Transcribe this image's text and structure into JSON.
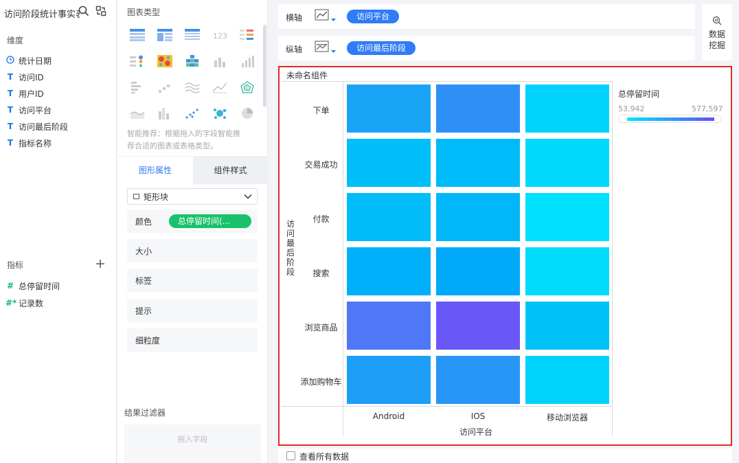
{
  "left_panel": {
    "dataset_title": "访问阶段统计事实表",
    "dimensions_title": "维度",
    "dimensions": [
      {
        "type_icon": "clock-icon",
        "label": "统计日期"
      },
      {
        "type_icon": "text-type-icon",
        "label": "访问ID"
      },
      {
        "type_icon": "text-type-icon",
        "label": "用户ID"
      },
      {
        "type_icon": "text-type-icon",
        "label": "访问平台"
      },
      {
        "type_icon": "text-type-icon",
        "label": "访问最后阶段"
      },
      {
        "type_icon": "text-type-icon",
        "label": "指标名称"
      }
    ],
    "metrics_title": "指标",
    "metrics": [
      {
        "type_icon": "hash-icon",
        "label": "总停留时间"
      },
      {
        "type_icon": "hash-star-icon",
        "label": "记录数"
      }
    ],
    "type_glyphs": {
      "text": "T",
      "hash": "#",
      "hash_star": "#*"
    }
  },
  "config_panel": {
    "chart_types_title": "图表类型",
    "recommendation": "智能推荐：根据拖入的字段智能推荐合适的图表或表格类型。",
    "tabs": [
      "图形属性",
      "组件样式"
    ],
    "shape_select": "矩形块",
    "properties": [
      {
        "label": "颜色",
        "value": "总停留时间(..."
      },
      {
        "label": "大小"
      },
      {
        "label": "标签"
      },
      {
        "label": "提示"
      },
      {
        "label": "细粒度"
      }
    ],
    "filter_title": "结果过滤器",
    "filter_placeholder": "拖入字段",
    "icon_123": "123"
  },
  "axes": {
    "x_label": "横轴",
    "x_field": "访问平台",
    "y_label": "纵轴",
    "y_field": "访问最后阶段"
  },
  "data_mining": {
    "line1": "数据",
    "line2": "挖掘"
  },
  "component": {
    "title": "未命名组件",
    "legend_title": "总停留时间",
    "legend_min": "53,942",
    "legend_max": "577,597"
  },
  "chart_data": {
    "type": "heatmap",
    "x_title": "访问平台",
    "y_title": "访问最后阶段",
    "x_categories": [
      "Android",
      "IOS",
      "移动浏览器"
    ],
    "y_categories": [
      "下单",
      "交易成功",
      "付款",
      "搜索",
      "浏览商品",
      "添加购物车"
    ],
    "color_field": "总停留时间",
    "color_range": [
      53942,
      577597
    ],
    "cell_colors": [
      [
        "#1aa4f6",
        "#2e8ff6",
        "#00d2fb"
      ],
      [
        "#00bff9",
        "#00bbfa",
        "#00d9fb"
      ],
      [
        "#00bcf9",
        "#00b7f9",
        "#00e1fd"
      ],
      [
        "#00aff9",
        "#00a9f9",
        "#00dbfb"
      ],
      [
        "#5077f7",
        "#6a57f8",
        "#00c2f9"
      ],
      [
        "#1d9ef7",
        "#2896f7",
        "#00d2fb"
      ]
    ]
  },
  "footer": {
    "show_all_label": "查看所有数据"
  }
}
